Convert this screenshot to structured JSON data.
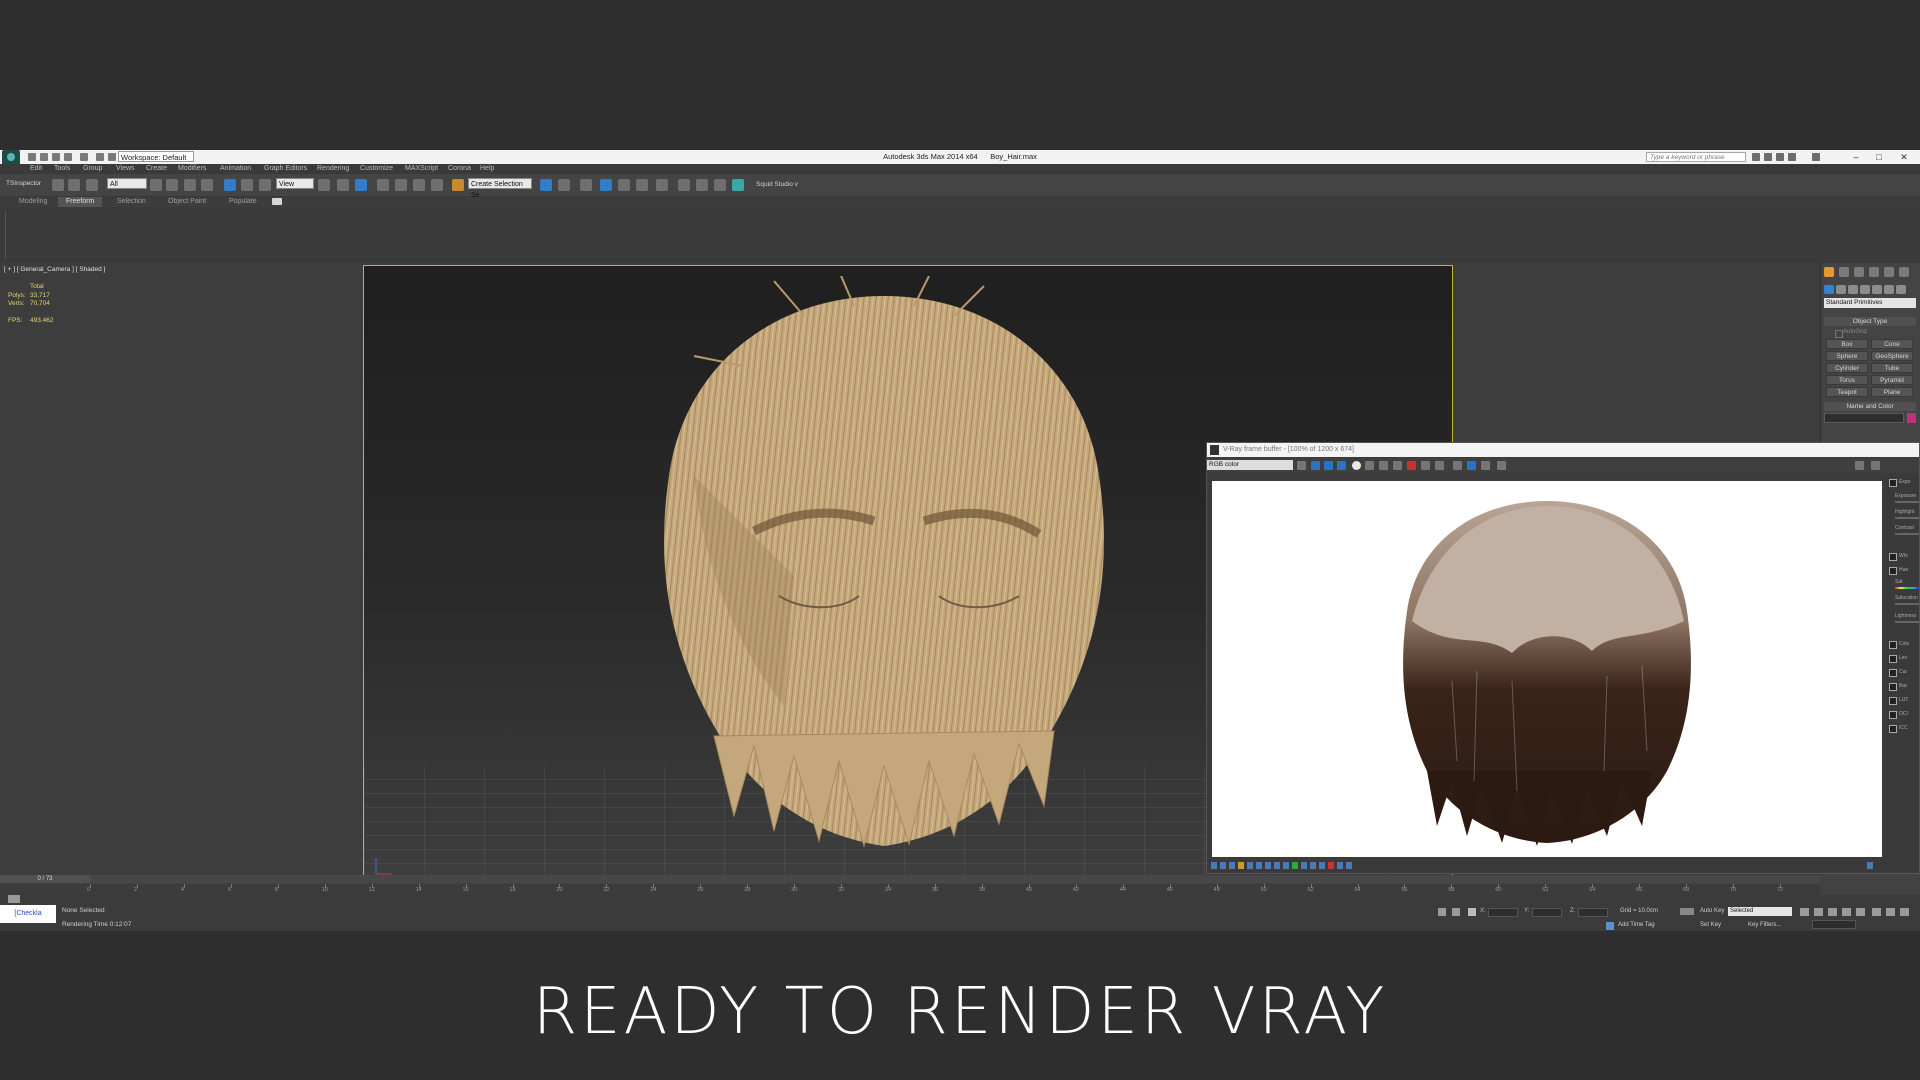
{
  "titlebar": {
    "workspace": "Workspace: Default",
    "app_title": "Autodesk 3ds Max 2014 x64",
    "file_name": "Boy_Hair.max",
    "search_placeholder": "Type a keyword or phrase",
    "minimize": "–",
    "maximize": "□",
    "close": "✕"
  },
  "menu": {
    "items": [
      "Edit",
      "Tools",
      "Group",
      "Views",
      "Create",
      "Modifiers",
      "Animation",
      "Graph Editors",
      "Rendering",
      "Customize",
      "MAXScript",
      "Corona",
      "Help"
    ]
  },
  "toolbar": {
    "tsinspector": "TSInspector",
    "selection_filter": "All",
    "reference_coord": "View",
    "named_selection": "Create Selection Se",
    "squid_studio": "Squid Studio v"
  },
  "ribbon": {
    "tabs": [
      "Modeling",
      "Freeform",
      "Selection",
      "Object Paint",
      "Populate"
    ],
    "active_tab": "Freeform"
  },
  "viewport": {
    "label": "[ + ] [ General_Camera ] [ Shaded ]",
    "stats_header": "Total",
    "polys_label": "Polys:",
    "polys_value": "33,717",
    "verts_label": "Verts:",
    "verts_value": "70,704",
    "fps_label": "FPS:",
    "fps_value": "493.462"
  },
  "command_panel": {
    "dropdown": "Standard Primitives",
    "object_type": "Object Type",
    "autogrid": "AutoGrid",
    "primitives": [
      "Box",
      "Cone",
      "Sphere",
      "GeoSphere",
      "Cylinder",
      "Tube",
      "Torus",
      "Pyramid",
      "Teapot",
      "Plane"
    ],
    "name_and_color": "Name and Color",
    "color": "#c1317a"
  },
  "vfb": {
    "title": "V-Ray frame buffer - [100% of 1200 x 674]",
    "channel": "RGB color",
    "side_labels": [
      "Expo",
      "Exposure",
      "Highlight",
      "Contrast",
      "Whi",
      "Hue",
      "Sat",
      "Saturation",
      "Lightness",
      "Colo",
      "Lev",
      "Cur",
      "Bac",
      "LUT",
      "OCI",
      "ICC"
    ]
  },
  "timeline": {
    "frame_display": "0 / 73",
    "ticks": [
      "0",
      "2",
      "4",
      "6",
      "8",
      "10",
      "12",
      "14",
      "16",
      "18",
      "20",
      "22",
      "24",
      "26",
      "28",
      "30",
      "32",
      "34",
      "36",
      "38",
      "40",
      "42",
      "44",
      "46",
      "48",
      "50",
      "52",
      "54",
      "56",
      "58",
      "60",
      "62",
      "64",
      "66",
      "68",
      "70",
      "72"
    ]
  },
  "status": {
    "maxscript": "[Checkla",
    "selection": "None Selected",
    "rendering_time": "Rendering Time 0:12:07",
    "x_label": "X:",
    "y_label": "Y:",
    "z_label": "Z:",
    "grid": "Grid = 10.0cm",
    "add_time_tag": "Add Time Tag",
    "auto_key": "Auto Key",
    "selected": "Selected",
    "set_key": "Set Key",
    "key_filters": "Key Filters..."
  },
  "caption": "READY TO RENDER VRAY",
  "colors": {
    "background": "#2e2e2e",
    "viewport_border": "#c7b238",
    "stats_text": "#e5d86a",
    "hair_viewport": "#c4a77a",
    "hair_render_dark": "#2a1a12",
    "hair_render_light": "#b8a595"
  }
}
